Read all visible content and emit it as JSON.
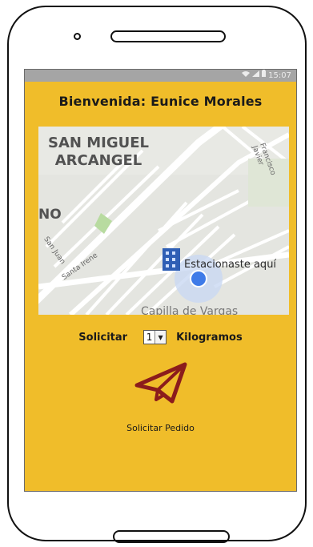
{
  "status_bar": {
    "time": "15:07",
    "icons": [
      "wifi-icon",
      "signal-icon",
      "battery-icon"
    ]
  },
  "header": {
    "welcome": "Bienvenida: Eunice Morales"
  },
  "map": {
    "area_line1": "SAN MIGUEL",
    "area_line2": "ARCANGEL",
    "partial_label": "NO",
    "parked_label": "Estacionaste aquí",
    "street_1": "Santa Irene",
    "street_2": "Francisco Javier",
    "street_3": "San Juan",
    "bottom_label": "Capilla de Vargas"
  },
  "order": {
    "request_label": "Solicitar",
    "quantity": "1",
    "unit_label": "Kilogramos"
  },
  "action": {
    "send_label": "Solicitar Pedido"
  },
  "colors": {
    "screen_bg": "#f0bd2a",
    "statusbar_bg": "#a5a5a5",
    "send_icon": "#8b1c1c",
    "location_dot": "#3f7be8"
  }
}
